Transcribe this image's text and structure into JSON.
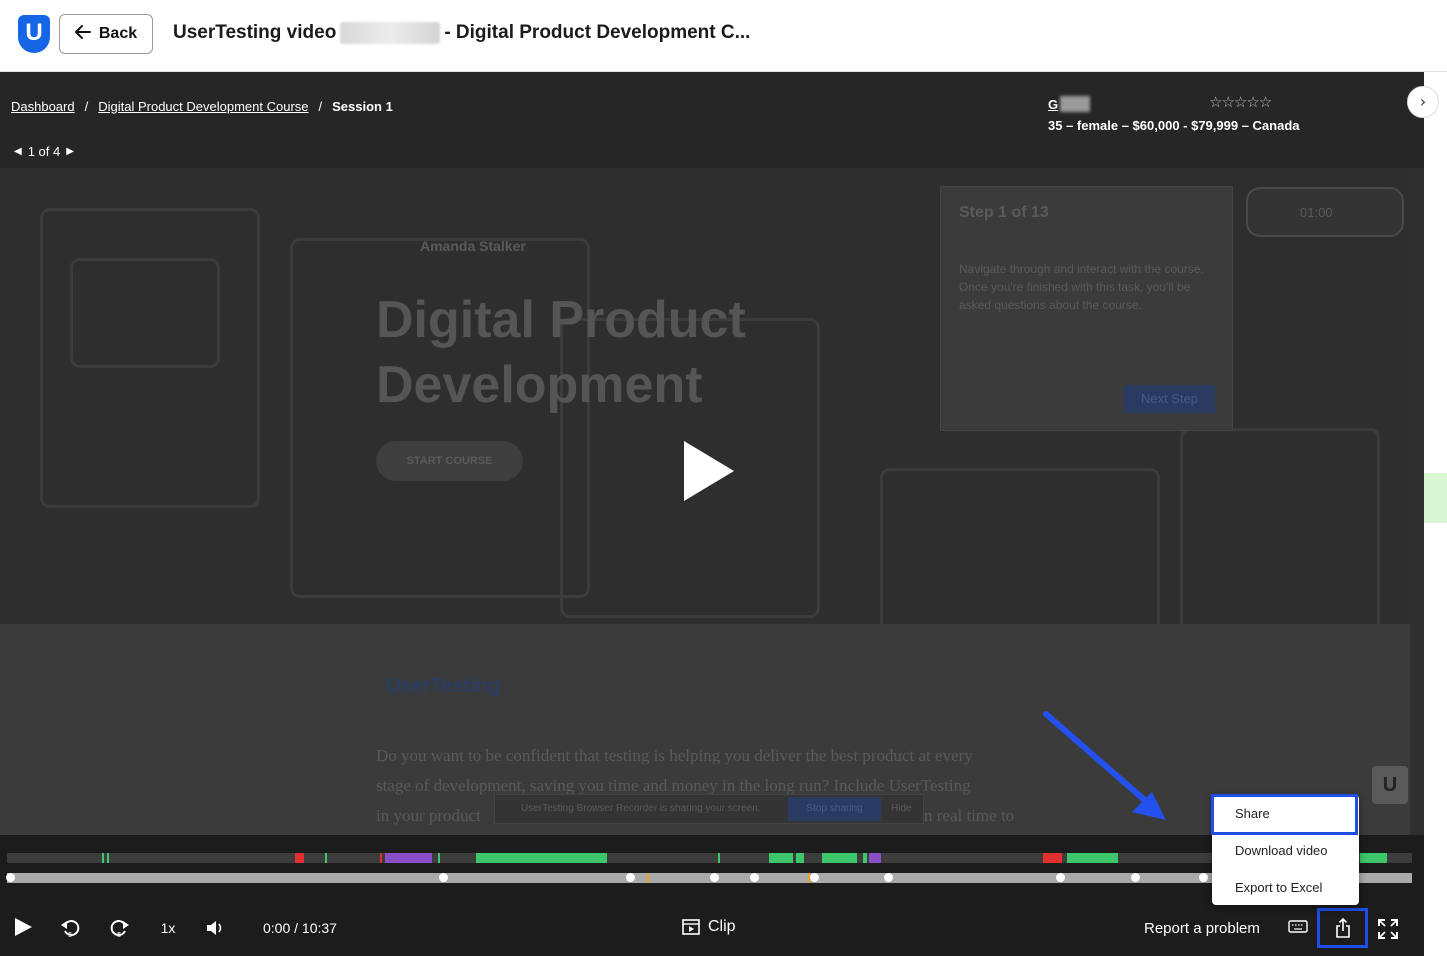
{
  "header": {
    "back_label": "Back",
    "title_prefix": "UserTesting video",
    "title_suffix": "- Digital Product Development C..."
  },
  "breadcrumb": {
    "dashboard": "Dashboard",
    "course": "Digital Product Development Course",
    "session": "Session 1",
    "separator": "/"
  },
  "pager": {
    "label": "1 of 4"
  },
  "tester": {
    "name_initial": "G",
    "demographics": "35 – female – $60,000 - $79,999 – Canada"
  },
  "video_content": {
    "author": "Amanda Stalker",
    "hero_title_1": "Digital Product",
    "hero_title_2": "Development",
    "start_button": "START COURSE",
    "task_step": "Step 1 of 13",
    "task_text": "Navigate through and interact with the course. Once you're finished with this task, you'll be asked questions about the course.",
    "next_step": "Next Step",
    "recorder_time": "01:00",
    "brand": "UserTesting",
    "body_text_1": "Do you want to be confident that testing is helping you deliver the best product at every",
    "body_text_2": "stage of development, saving you time and money in the long run? Include UserTesting",
    "body_text_3": "in your product",
    "body_text_3b": "n real time to",
    "sharing_banner": "UserTesting Browser Recorder is sharing your screen.",
    "stop_sharing": "Stop sharing",
    "hide": "Hide"
  },
  "controls": {
    "speed": "1x",
    "time": "0:00 / 10:37",
    "clip_label": "Clip",
    "report_label": "Report a problem"
  },
  "share_menu": {
    "items": [
      "Share",
      "Download video",
      "Export to Excel"
    ]
  },
  "colors": {
    "accent": "#1f4fe6",
    "brand": "#1565e6",
    "tag_green": "#3cc86a",
    "tag_red": "#e03030",
    "tag_purple": "#8a4fc8"
  }
}
